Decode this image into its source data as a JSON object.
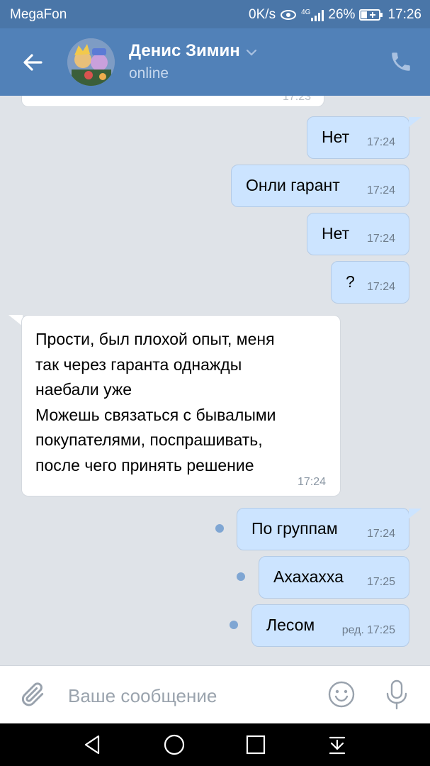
{
  "status_bar": {
    "carrier": "MegaFon",
    "speed": "0K/s",
    "network": "4G",
    "battery": "26%",
    "time": "17:26"
  },
  "header": {
    "back_icon": "arrow-left-icon",
    "name": "Денис Зимин",
    "status": "online",
    "call_icon": "phone-icon"
  },
  "messages": [
    {
      "id": "m0",
      "direction": "incoming",
      "text": "",
      "time": "17:23"
    },
    {
      "id": "m1",
      "direction": "outgoing",
      "text": "Нет",
      "time": "17:24"
    },
    {
      "id": "m2",
      "direction": "outgoing",
      "text": "Онли гарант",
      "time": "17:24"
    },
    {
      "id": "m3",
      "direction": "outgoing",
      "text": "Нет",
      "time": "17:24"
    },
    {
      "id": "m4",
      "direction": "outgoing",
      "text": "?",
      "time": "17:24"
    },
    {
      "id": "m5",
      "direction": "incoming",
      "text": "Прости, был плохой опыт, меня\nтак через гаранта однажды\nнаебали уже\nМожешь связаться с бывалыми\nпокупателями, поспрашивать,\nпосле чего принять решение",
      "time": "17:24"
    },
    {
      "id": "m6",
      "direction": "outgoing",
      "text": "По группам",
      "time": "17:24",
      "unread": true
    },
    {
      "id": "m7",
      "direction": "outgoing",
      "text": "Ахахахха",
      "time": "17:25",
      "unread": true
    },
    {
      "id": "m8",
      "direction": "outgoing",
      "text": "Лесом",
      "edited_prefix": "ред.",
      "time": "17:25",
      "unread": true
    }
  ],
  "composer": {
    "placeholder": "Ваше сообщение",
    "attach_icon": "paperclip-icon",
    "emoji_icon": "smile-icon",
    "voice_icon": "microphone-icon"
  },
  "nav_bar": {
    "back_icon": "triangle-back-icon",
    "home_icon": "circle-home-icon",
    "recents_icon": "square-recents-icon",
    "notifications_icon": "pull-down-icon"
  },
  "colors": {
    "header": "#5181b8",
    "status_bar": "#4a76a8",
    "outgoing_bubble": "#cce4ff",
    "incoming_bubble": "#ffffff",
    "chat_background": "#dfe3e8",
    "unread_dot": "#7fa6d3"
  }
}
